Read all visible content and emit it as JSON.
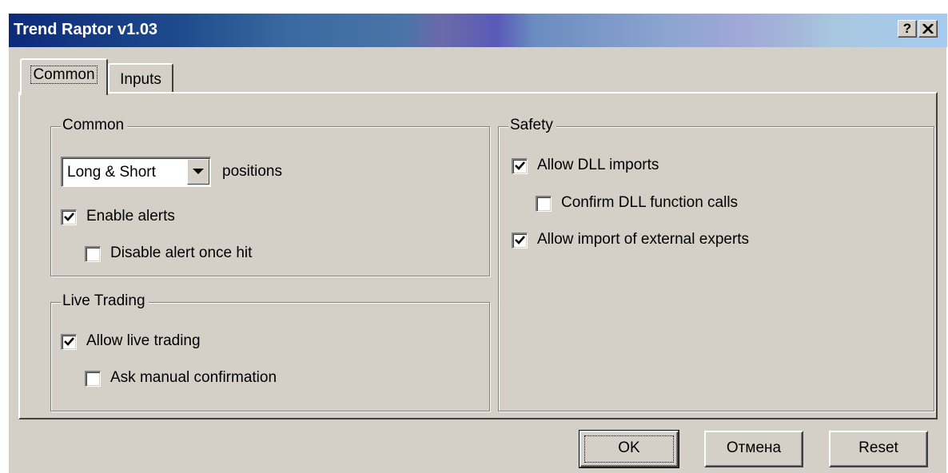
{
  "window": {
    "title": "Trend Raptor v1.03",
    "help_label": "?",
    "colors": {
      "face": "#d4d0c8",
      "title_start": "#0c2a7a",
      "title_end": "#a6caf0"
    }
  },
  "tabs": [
    {
      "label": "Common",
      "active": true
    },
    {
      "label": "Inputs",
      "active": false
    }
  ],
  "common_group": {
    "legend": "Common",
    "positions_select": {
      "value": "Long & Short"
    },
    "positions_label": "positions",
    "enable_alerts": {
      "label": "Enable alerts",
      "checked": true
    },
    "disable_alert_once_hit": {
      "label": "Disable alert once hit",
      "checked": false
    }
  },
  "live_trading_group": {
    "legend": "Live Trading",
    "allow_live_trading": {
      "label": "Allow live trading",
      "checked": true
    },
    "ask_manual_confirmation": {
      "label": "Ask manual confirmation",
      "checked": false
    }
  },
  "safety_group": {
    "legend": "Safety",
    "allow_dll_imports": {
      "label": "Allow DLL imports",
      "checked": true
    },
    "confirm_dll_function_calls": {
      "label": "Confirm DLL function calls",
      "checked": false
    },
    "allow_import_external_experts": {
      "label": "Allow import of external experts",
      "checked": true
    }
  },
  "buttons": {
    "ok": "OK",
    "cancel": "Отмена",
    "reset": "Reset"
  }
}
